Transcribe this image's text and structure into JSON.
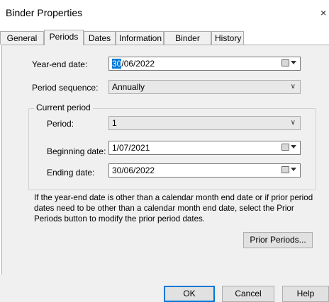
{
  "window": {
    "title": "Binder Properties",
    "close_glyph": "×"
  },
  "tabs": [
    {
      "label": "General",
      "active": false
    },
    {
      "label": "Periods",
      "active": true
    },
    {
      "label": "Dates",
      "active": false
    },
    {
      "label": "Information",
      "active": false
    },
    {
      "label": "Binder Staff",
      "active": false
    },
    {
      "label": "History",
      "active": false
    }
  ],
  "form": {
    "year_end": {
      "label": "Year-end date:",
      "value_highlight": "30",
      "value_rest": "/06/2022"
    },
    "period_sequence": {
      "label": "Period sequence:",
      "value": "Annually"
    },
    "current_period": {
      "group_label": "Current period",
      "period": {
        "label": "Period:",
        "value": "1"
      },
      "beginning": {
        "label": "Beginning date:",
        "value": "1/07/2021"
      },
      "ending": {
        "label": "Ending date:",
        "value": "30/06/2022"
      }
    },
    "note": "If the year-end date is other than a calendar month end date or if prior period dates need to be other than a calendar month end date, select the Prior Periods button to modify the prior period dates."
  },
  "buttons": {
    "prior_periods": "Prior Periods...",
    "ok": "OK",
    "cancel": "Cancel",
    "help": "Help"
  },
  "icons": {
    "dropdown": "chevron-down-icon",
    "calendar": "calendar-icon"
  },
  "colors": {
    "accent": "#0078d7",
    "dialog_bg": "#f0f0f0"
  }
}
